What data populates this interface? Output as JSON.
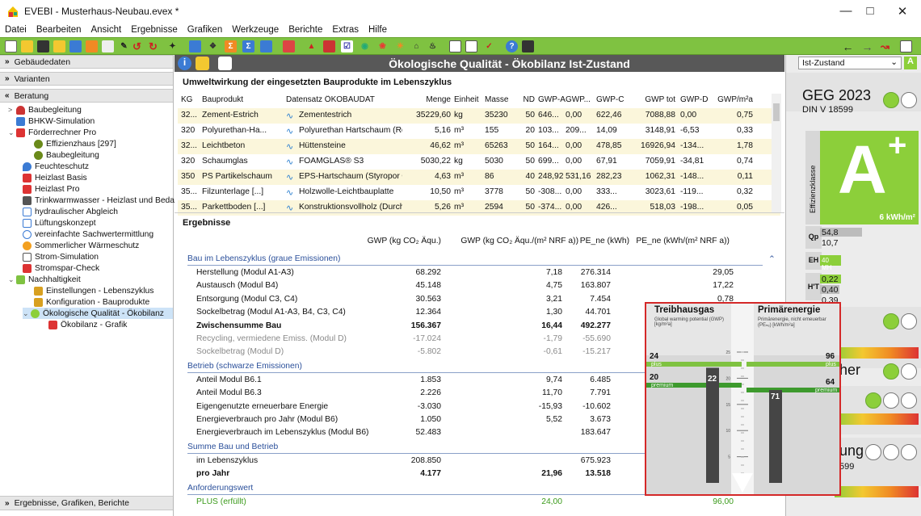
{
  "window": {
    "app_name": "EVEBI",
    "title": "EVEBI - Musterhaus-Neubau.evex *"
  },
  "menu": [
    "Datei",
    "Bearbeiten",
    "Ansicht",
    "Ergebnisse",
    "Grafiken",
    "Werkzeuge",
    "Berichte",
    "Extras",
    "Hilfe"
  ],
  "sidebar": {
    "sections": [
      "Gebäudedaten",
      "Varianten",
      "Beratung"
    ],
    "footer": "Ergebnisse, Grafiken, Berichte",
    "tree": [
      "Baubegleitung",
      "BHKW-Simulation",
      "Förderrechner Pro",
      "Effizienzhaus [297]",
      "Baubegleitung",
      "Feuchteschutz",
      "Heizlast Basis",
      "Heizlast Pro",
      "Trinkwarmwasser - Heizlast und Bedarf",
      "hydraulischer Abgleich",
      "Lüftungskonzept",
      "vereinfachte Sachwertermittlung",
      "Sommerlicher Wärmeschutz",
      "Strom-Simulation",
      "Stromspar-Check",
      "Nachhaltigkeit",
      "Einstellungen - Lebenszyklus",
      "Konfiguration - Bauprodukte",
      "Ökologische Qualität - Ökobilanz",
      "Ökobilanz - Grafik"
    ]
  },
  "main": {
    "title": "Ökologische Qualität - Ökobilanz Ist-Zustand",
    "products_title": "Umweltwirkung der eingesetzten Bauprodukte im Lebenszyklus",
    "product_headers": [
      "KG",
      "Bauprodukt",
      "Datensatz ÖKOBAUDAT",
      "Menge",
      "Einheit",
      "Masse",
      "ND",
      "GWP-A",
      "GWP...",
      "GWP-C",
      "GWP tot",
      "GWP-D",
      "GWP/m²a"
    ],
    "products": [
      [
        "32...",
        "Zement-Estrich",
        "Zementestrich",
        "35229,60",
        "kg",
        "35230",
        "50",
        "646...",
        "0,00",
        "622,46",
        "7088,88",
        "0,00",
        "0,75"
      ],
      [
        "320",
        "Polyurethan-Ha...",
        "Polyurethan Hartschaum (Rohris...",
        "5,16",
        "m³",
        "155",
        "20",
        "103...",
        "209...",
        "14,09",
        "3148,91",
        "-6,53",
        "0,33"
      ],
      [
        "32...",
        "Leichtbeton",
        "Hüttensteine",
        "46,62",
        "m³",
        "65263",
        "50",
        "164...",
        "0,00",
        "478,85",
        "16926,94",
        "-134...",
        "1,78"
      ],
      [
        "320",
        "Schaumglas",
        "FOAMGLAS® S3",
        "5030,22",
        "kg",
        "5030",
        "50",
        "699...",
        "0,00",
        "67,91",
        "7059,91",
        "-34,81",
        "0,74"
      ],
      [
        "350",
        "PS Partikelschaum",
        "EPS-Hartschaum (Styropor ®) fü...",
        "4,63",
        "m³",
        "86",
        "40",
        "248,92",
        "531,16",
        "282,23",
        "1062,31",
        "-148...",
        "0,11"
      ],
      [
        "35...",
        "Filzunterlage [...]",
        "Holzwolle-Leichtbauplatte",
        "10,50",
        "m³",
        "3778",
        "50",
        "-308...",
        "0,00",
        "333...",
        "3023,61",
        "-119...",
        "0,32"
      ],
      [
        "35...",
        "Parkettboden [...]",
        "Konstruktionsvollholz (Durchschni...",
        "5,26",
        "m³",
        "2594",
        "50",
        "-374...",
        "0,00",
        "426...",
        "518,03",
        "-198...",
        "0,05"
      ]
    ],
    "results_title": "Ergebnisse",
    "results_headers": [
      "GWP (kg CO₂ Äqu.)",
      "GWP (kg CO₂ Äqu./(m² NRF a))",
      "PE_ne (kWh)",
      "PE_ne (kWh/(m² NRF a))"
    ],
    "groups": {
      "bau": "Bau im Lebenszyklus (graue Emissionen)",
      "betrieb": "Betrieb (schwarze Emissionen)",
      "summe": "Summe Bau und Betrieb",
      "anforderung": "Anforderungswert"
    },
    "rows_bau": [
      [
        "Herstellung (Modul A1-A3)",
        "68.292",
        "7,18",
        "276.314",
        "29,05"
      ],
      [
        "Austausch (Modul B4)",
        "45.148",
        "4,75",
        "163.807",
        "17,22"
      ],
      [
        "Entsorgung (Modul C3, C4)",
        "30.563",
        "3,21",
        "7.454",
        "0,78"
      ],
      [
        "Sockelbetrag (Modul A1-A3, B4, C3, C4)",
        "12.364",
        "1,30",
        "44.701",
        ""
      ],
      [
        "Zwischensumme Bau",
        "156.367",
        "16,44",
        "492.277",
        ""
      ],
      [
        "Recycling, vermiedene Emiss. (Modul D)",
        "-17.024",
        "-1,79",
        "-55.690",
        ""
      ],
      [
        "Sockelbetrag (Modul D)",
        "-5.802",
        "-0,61",
        "-15.217",
        ""
      ]
    ],
    "rows_betrieb": [
      [
        "Anteil Modul B6.1",
        "1.853",
        "9,74",
        "6.485",
        ""
      ],
      [
        "Anteil Modul B6.3",
        "2.226",
        "11,70",
        "7.791",
        ""
      ],
      [
        "Eigengenutzte erneuerbare Energie",
        "-3.030",
        "-15,93",
        "-10.602",
        ""
      ],
      [
        "Energieverbrauch pro Jahr (Modul B6)",
        "1.050",
        "5,52",
        "3.673",
        ""
      ],
      [
        "Energieverbrauch im Lebenszyklus (Modul B6)",
        "52.483",
        "",
        "183.647",
        ""
      ]
    ],
    "rows_summe": [
      [
        "im Lebenszyklus",
        "208.850",
        "",
        "675.923",
        ""
      ],
      [
        "pro Jahr",
        "4.177",
        "21,96",
        "13.518",
        ""
      ]
    ],
    "rows_anforderung": [
      [
        "PLUS (erfüllt)",
        "",
        "24,00",
        "",
        "96,00"
      ]
    ]
  },
  "right_panel": {
    "variant": "Ist-Zustand",
    "geg_title": "GEG 2023",
    "din": "DIN V 18599",
    "efficiency_label": "Effizienzklasse",
    "grade": "A",
    "grade_plus": "+",
    "grade_value": "6 kWh/m²",
    "qp_label": "Qp",
    "qp_values": [
      "54,8",
      "10,7"
    ],
    "eh_label": "EH",
    "eh_value": "40 MH",
    "ht_label": "H'T",
    "ht_values": [
      "0,22",
      "0,40",
      "0,39"
    ],
    "partial_text_1": "her",
    "partial_text_2": "ung",
    "partial_text_3": "599"
  },
  "popup": {
    "left_title": "Treibhausgas",
    "left_sub": "Global warming potential (GWP) [kg/m²a]",
    "right_title": "Primärenergie",
    "right_sub": "Primärenergie, nicht erneuerbar (PEₙₑ) [kWh/m²a]",
    "plus_label_l": "24",
    "plus_tag_l": "plus",
    "premium_label_l": "20",
    "premium_tag_l": "premium",
    "bar_l_value": "22",
    "plus_label_r": "96",
    "plus_tag_r": "plus",
    "premium_label_r": "64",
    "premium_tag_r": "premium",
    "bar_r_value": "71",
    "scale_ticks": [
      "25",
      "20",
      "15",
      "10",
      "5"
    ],
    "gwp_bar_level": 22,
    "pe_bar_level": 71
  },
  "colors": {
    "accent": "#7fc241",
    "header": "#585858",
    "highlight": "#fbf6db",
    "group": "#2a4f9a",
    "popup_border": "#d42828",
    "efficiency": "#8ccf3a"
  }
}
